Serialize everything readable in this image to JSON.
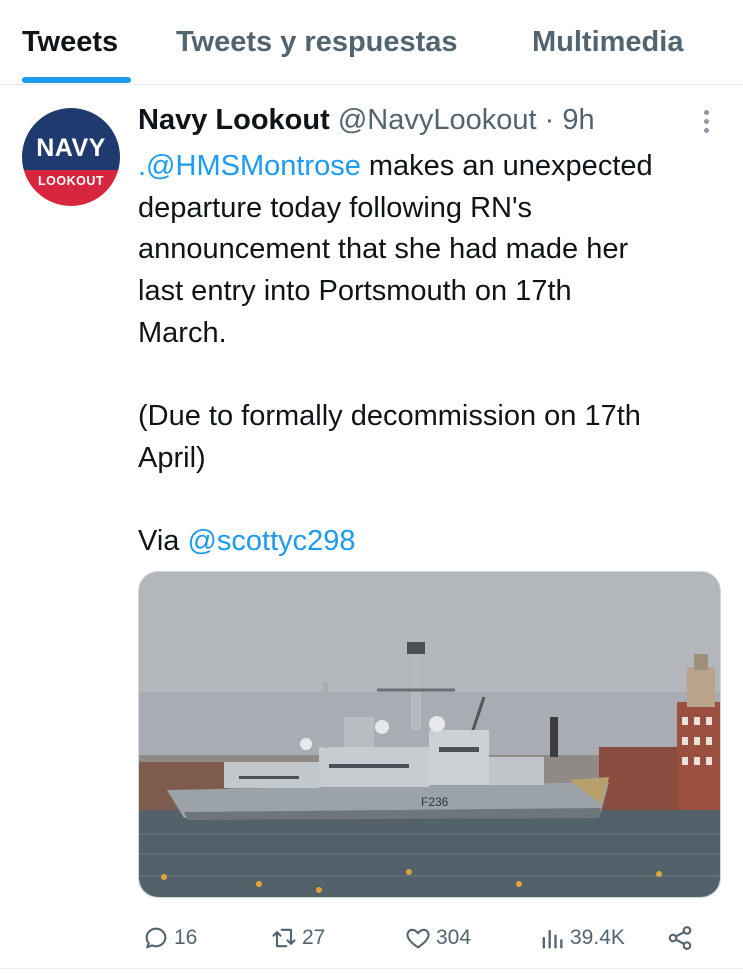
{
  "tabs": {
    "items": [
      "Tweets",
      "Tweets y respuestas",
      "Multimedia"
    ],
    "active": 0
  },
  "tweet": {
    "avatar": {
      "line1": "NAVY",
      "line2": "LOOKOUT"
    },
    "author_name": "Navy Lookout",
    "author_handle": "@NavyLookout",
    "separator": " · ",
    "time": "9h",
    "text": {
      "mention": ".@HMSMontrose",
      "line1_rest": " makes an unexpected",
      "line2": "departure today following RN's",
      "line3": "announcement that she had made her",
      "line4": "last entry into Portsmouth on 17th",
      "line5": "March.",
      "line6": "(Due to formally decommission on 17th",
      "line7": "April)",
      "via_prefix": "Via ",
      "via_handle": "@scottyc298"
    },
    "media": {
      "pennant_number": "F236"
    },
    "actions": {
      "replies": "16",
      "retweets": "27",
      "likes": "304",
      "views": "39.4K"
    }
  },
  "icons": {
    "reply": "reply-icon",
    "retweet": "retweet-icon",
    "like": "heart-icon",
    "views": "views-icon",
    "share": "share-icon",
    "more": "more-vertical-icon"
  },
  "colors": {
    "accent": "#1d9bf0",
    "secondary_text": "#536471",
    "primary_text": "#0f1419",
    "avatar_blue": "#1f3a6e",
    "avatar_red": "#d7263d"
  }
}
